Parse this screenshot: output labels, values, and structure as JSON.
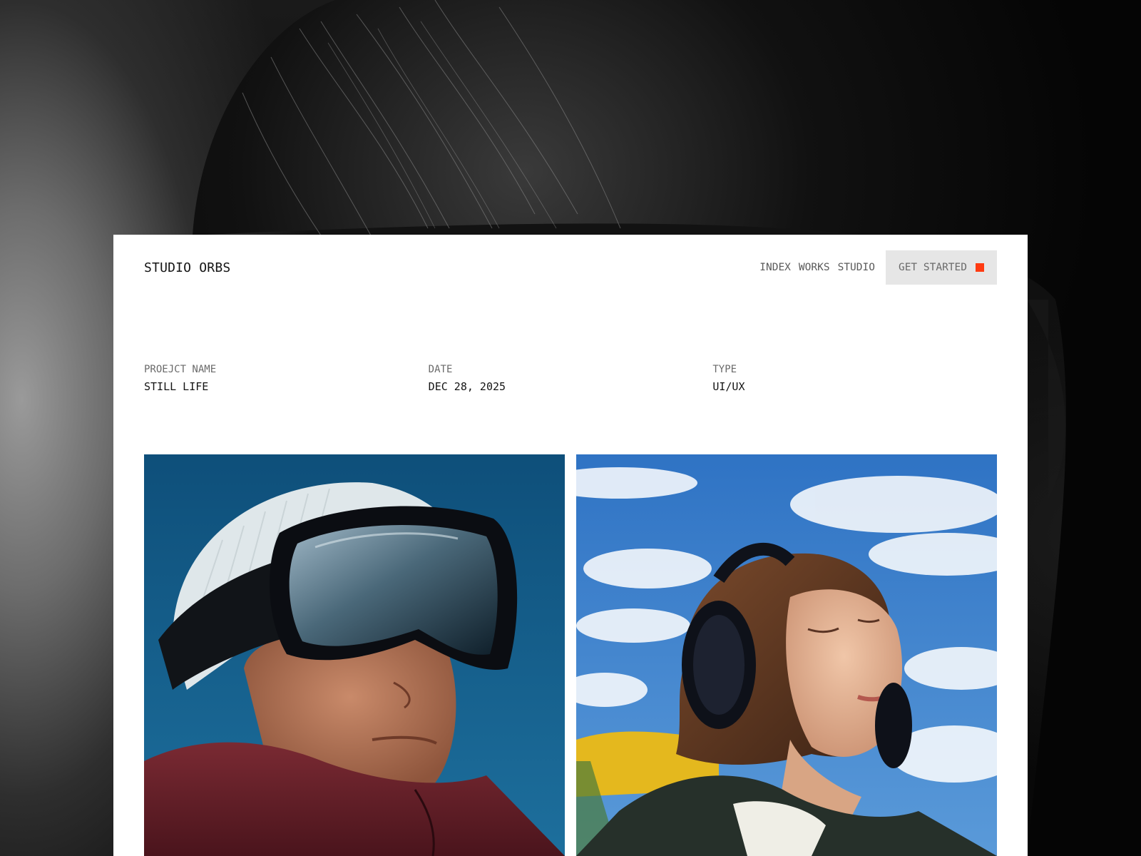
{
  "brand": {
    "name": "STUDIO ORBS"
  },
  "nav": {
    "links": [
      "INDEX",
      "WORKS",
      "STUDIO"
    ],
    "cta_label": "GET STARTED",
    "cta_accent": "#ff3b12"
  },
  "project": {
    "fields": [
      {
        "label": "PROEJCT NAME",
        "value": "STILL LIFE"
      },
      {
        "label": "DATE",
        "value": "DEC 28, 2025"
      },
      {
        "label": "TYPE",
        "value": "UI/UX"
      }
    ]
  },
  "gallery": {
    "images": [
      {
        "icon": "skier-goggles-photo"
      },
      {
        "icon": "headphones-portrait-photo"
      }
    ]
  },
  "colors": {
    "page_bg": "#ffffff",
    "accent": "#ff3b12",
    "cta_bg": "#e6e6e6"
  }
}
